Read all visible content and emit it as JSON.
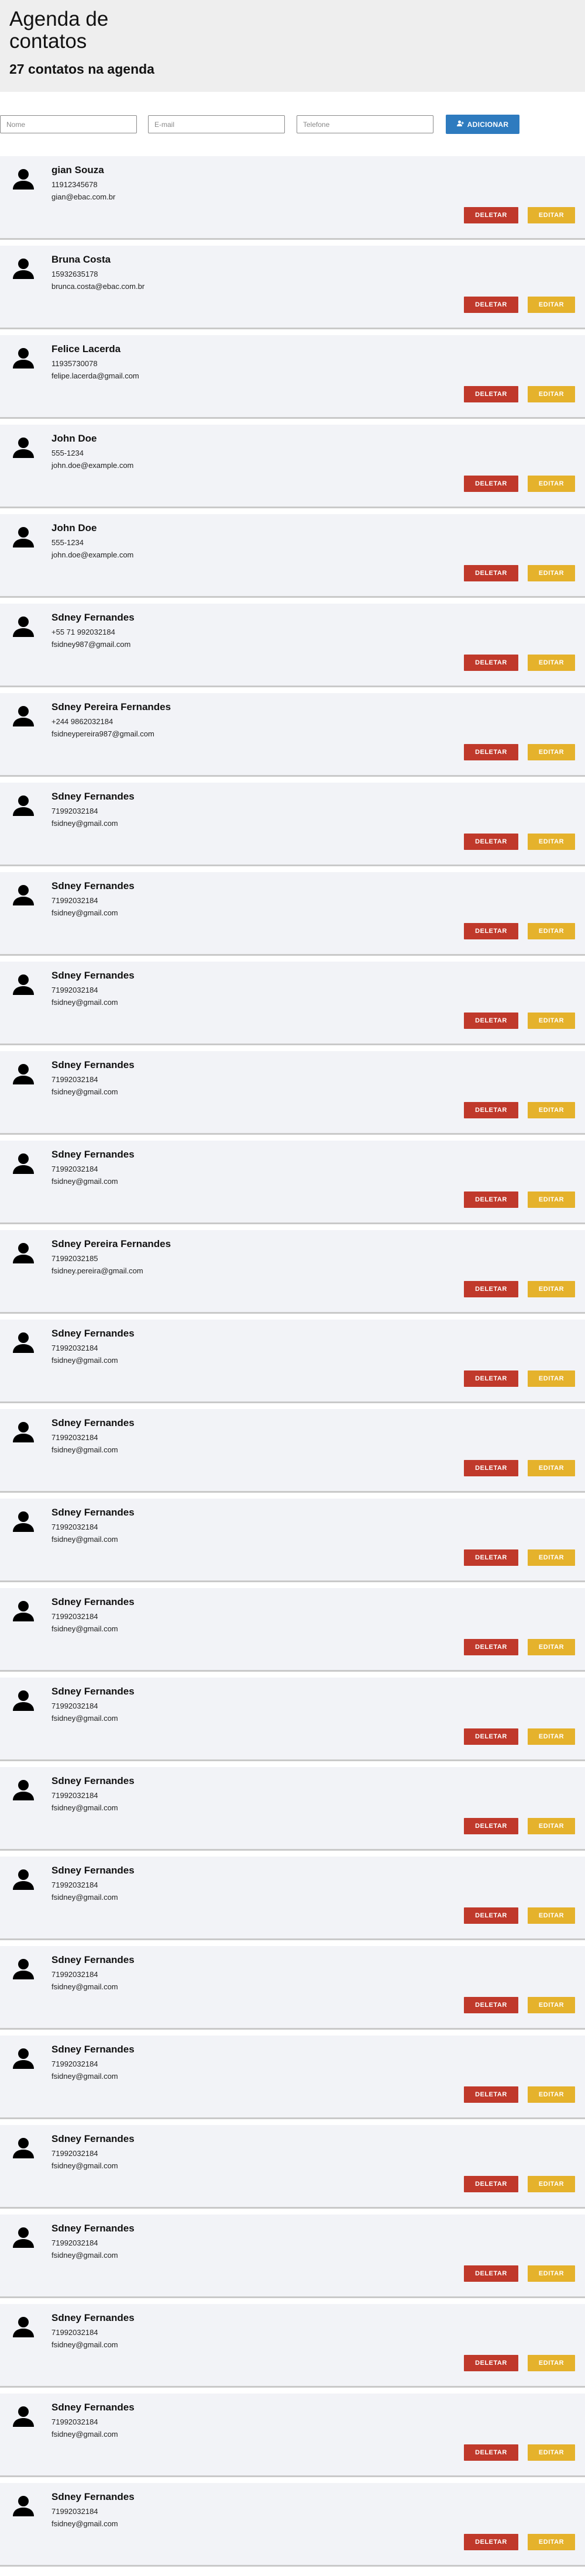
{
  "header": {
    "title": "Agenda de contatos",
    "subtitle": "27 contatos na agenda"
  },
  "form": {
    "name_placeholder": "Nome",
    "email_placeholder": "E-mail",
    "phone_placeholder": "Telefone",
    "add_label": "ADICIONAR"
  },
  "buttons": {
    "delete_label": "DELETAR",
    "edit_label": "EDITAR"
  },
  "colors": {
    "add": "#2e7bbf",
    "delete": "#c0392b",
    "edit": "#e5b22c"
  },
  "contacts": [
    {
      "name": "gian Souza",
      "phone": "11912345678",
      "email": "gian@ebac.com.br"
    },
    {
      "name": "Bruna Costa",
      "phone": "15932635178",
      "email": "brunca.costa@ebac.com.br"
    },
    {
      "name": "Felice Lacerda",
      "phone": "11935730078",
      "email": "felipe.lacerda@gmail.com"
    },
    {
      "name": "John Doe",
      "phone": "555-1234",
      "email": "john.doe@example.com"
    },
    {
      "name": "John Doe",
      "phone": "555-1234",
      "email": "john.doe@example.com"
    },
    {
      "name": "Sdney Fernandes",
      "phone": "+55 71 992032184",
      "email": "fsidney987@gmail.com"
    },
    {
      "name": "Sdney Pereira Fernandes",
      "phone": "+244 9862032184",
      "email": "fsidneypereira987@gmail.com"
    },
    {
      "name": "Sdney Fernandes",
      "phone": "71992032184",
      "email": "fsidney@gmail.com"
    },
    {
      "name": "Sdney Fernandes",
      "phone": "71992032184",
      "email": "fsidney@gmail.com"
    },
    {
      "name": "Sdney Fernandes",
      "phone": "71992032184",
      "email": "fsidney@gmail.com"
    },
    {
      "name": "Sdney Fernandes",
      "phone": "71992032184",
      "email": "fsidney@gmail.com"
    },
    {
      "name": "Sdney Fernandes",
      "phone": "71992032184",
      "email": "fsidney@gmail.com"
    },
    {
      "name": "Sdney Pereira Fernandes",
      "phone": "71992032185",
      "email": "fsidney.pereira@gmail.com"
    },
    {
      "name": "Sdney Fernandes",
      "phone": "71992032184",
      "email": "fsidney@gmail.com"
    },
    {
      "name": "Sdney Fernandes",
      "phone": "71992032184",
      "email": "fsidney@gmail.com"
    },
    {
      "name": "Sdney Fernandes",
      "phone": "71992032184",
      "email": "fsidney@gmail.com"
    },
    {
      "name": "Sdney Fernandes",
      "phone": "71992032184",
      "email": "fsidney@gmail.com"
    },
    {
      "name": "Sdney Fernandes",
      "phone": "71992032184",
      "email": "fsidney@gmail.com"
    },
    {
      "name": "Sdney Fernandes",
      "phone": "71992032184",
      "email": "fsidney@gmail.com"
    },
    {
      "name": "Sdney Fernandes",
      "phone": "71992032184",
      "email": "fsidney@gmail.com"
    },
    {
      "name": "Sdney Fernandes",
      "phone": "71992032184",
      "email": "fsidney@gmail.com"
    },
    {
      "name": "Sdney Fernandes",
      "phone": "71992032184",
      "email": "fsidney@gmail.com"
    },
    {
      "name": "Sdney Fernandes",
      "phone": "71992032184",
      "email": "fsidney@gmail.com"
    },
    {
      "name": "Sdney Fernandes",
      "phone": "71992032184",
      "email": "fsidney@gmail.com"
    },
    {
      "name": "Sdney Fernandes",
      "phone": "71992032184",
      "email": "fsidney@gmail.com"
    },
    {
      "name": "Sdney Fernandes",
      "phone": "71992032184",
      "email": "fsidney@gmail.com"
    },
    {
      "name": "Sdney Fernandes",
      "phone": "71992032184",
      "email": "fsidney@gmail.com"
    }
  ]
}
